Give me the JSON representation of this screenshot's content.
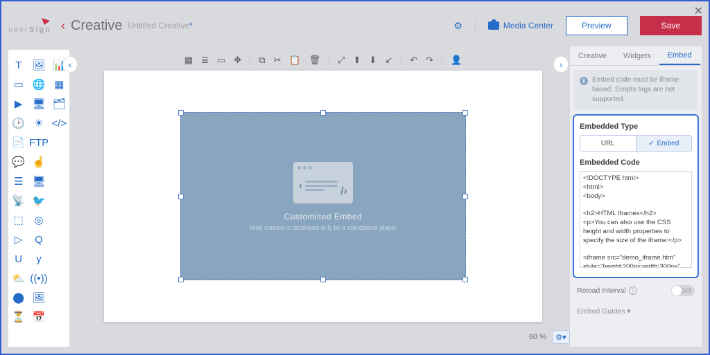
{
  "header": {
    "section": "Creative",
    "filename": "Untitled Creative",
    "media_center": "Media Center",
    "preview": "Preview",
    "save": "Save"
  },
  "tools": [
    {
      "name": "text-icon",
      "g": "T"
    },
    {
      "name": "image-icon",
      "g": "🖼"
    },
    {
      "name": "chart-icon",
      "g": "📊"
    },
    {
      "name": "shape-icon",
      "g": "▭"
    },
    {
      "name": "globe-icon",
      "g": "🌐"
    },
    {
      "name": "table-icon",
      "g": "▦"
    },
    {
      "name": "video-icon",
      "g": "▶"
    },
    {
      "name": "slideshow-icon",
      "g": "🖥"
    },
    {
      "name": "gallery-icon",
      "g": "🗂"
    },
    {
      "name": "clock-icon",
      "g": "🕒"
    },
    {
      "name": "weather-icon",
      "g": "☀"
    },
    {
      "name": "code-icon",
      "g": "</>"
    },
    {
      "name": "page-icon",
      "g": "📄"
    },
    {
      "name": "ftp-icon",
      "g": "FTP"
    },
    {
      "name": "blank-icon",
      "g": ""
    },
    {
      "name": "ticker-icon",
      "g": "💬"
    },
    {
      "name": "touch-icon",
      "g": "☝"
    },
    {
      "name": "blank2-icon",
      "g": ""
    },
    {
      "name": "list-icon",
      "g": "☰"
    },
    {
      "name": "screen-icon",
      "g": "🖥"
    },
    {
      "name": "blank3-icon",
      "g": ""
    },
    {
      "name": "rss-icon",
      "g": "📡"
    },
    {
      "name": "twitter-icon",
      "g": "🐦"
    },
    {
      "name": "blank4-icon",
      "g": ""
    },
    {
      "name": "facebook-icon",
      "g": "⬚"
    },
    {
      "name": "instagram-icon",
      "g": "◎"
    },
    {
      "name": "blank5-icon",
      "g": ""
    },
    {
      "name": "youtube-icon",
      "g": "▷"
    },
    {
      "name": "search-icon",
      "g": "Q"
    },
    {
      "name": "blank6-icon",
      "g": ""
    },
    {
      "name": "ustream-icon",
      "g": "U"
    },
    {
      "name": "yelp-icon",
      "g": "y"
    },
    {
      "name": "blank7-icon",
      "g": ""
    },
    {
      "name": "partly-icon",
      "g": "⛅"
    },
    {
      "name": "signal-icon",
      "g": "((•))"
    },
    {
      "name": "blank8-icon",
      "g": ""
    },
    {
      "name": "poll-icon",
      "g": "⬤"
    },
    {
      "name": "photo-icon",
      "g": "🖼"
    },
    {
      "name": "blank9-icon",
      "g": ""
    },
    {
      "name": "timer-icon",
      "g": "⏳"
    },
    {
      "name": "calendar-icon",
      "g": "📅"
    },
    {
      "name": "blank10-icon",
      "g": ""
    }
  ],
  "canvas_toolbar": [
    {
      "name": "grid-icon",
      "g": "▦"
    },
    {
      "name": "align-icon",
      "g": "≣"
    },
    {
      "name": "ratio-icon",
      "g": "▭"
    },
    {
      "name": "move-icon",
      "g": "✥"
    },
    {
      "name": "sep",
      "g": "|"
    },
    {
      "name": "copy-icon",
      "g": "⧉"
    },
    {
      "name": "cut-icon",
      "g": "✂"
    },
    {
      "name": "paste-icon",
      "g": "📋"
    },
    {
      "name": "delete-icon",
      "g": "🗑"
    },
    {
      "name": "sep",
      "g": "|"
    },
    {
      "name": "fit-icon",
      "g": "⤢"
    },
    {
      "name": "front-icon",
      "g": "⬆"
    },
    {
      "name": "back-icon",
      "g": "⬇"
    },
    {
      "name": "behind-icon",
      "g": "↙"
    },
    {
      "name": "sep",
      "g": "|"
    },
    {
      "name": "undo-icon",
      "g": "↶"
    },
    {
      "name": "redo-icon",
      "g": "↷"
    },
    {
      "name": "sep",
      "g": "|"
    },
    {
      "name": "user-icon",
      "g": "👤"
    }
  ],
  "canvas": {
    "widget_title": "Customised Embed",
    "widget_sub": "Web content is displayed only by a standalone player",
    "zoom": "60 %"
  },
  "panel": {
    "tabs": [
      "Creative",
      "Widgets",
      "Embed"
    ],
    "notice": "Embed code must be iframe-based. Scripts tags are not supported.",
    "type_hd": "Embedded Type",
    "seg_url": "URL",
    "seg_embed": "Embed",
    "code_hd": "Embedded Code",
    "code": "<!DOCTYPE html>\n<html>\n<body>\n\n<h2>HTML Iframes</h2>\n<p>You can also use the CSS height and width properties to specify the size of the iframe:</p>\n\n<iframe src=\"demo_iframe.htm\" style=\"height:200px;width:300px\" title=\"Iframe Example\"></iframe>\n\n</body>\n</html>",
    "reload": "Reload Interval",
    "toggle_off": "OFF",
    "guides": "Embed Guides"
  }
}
